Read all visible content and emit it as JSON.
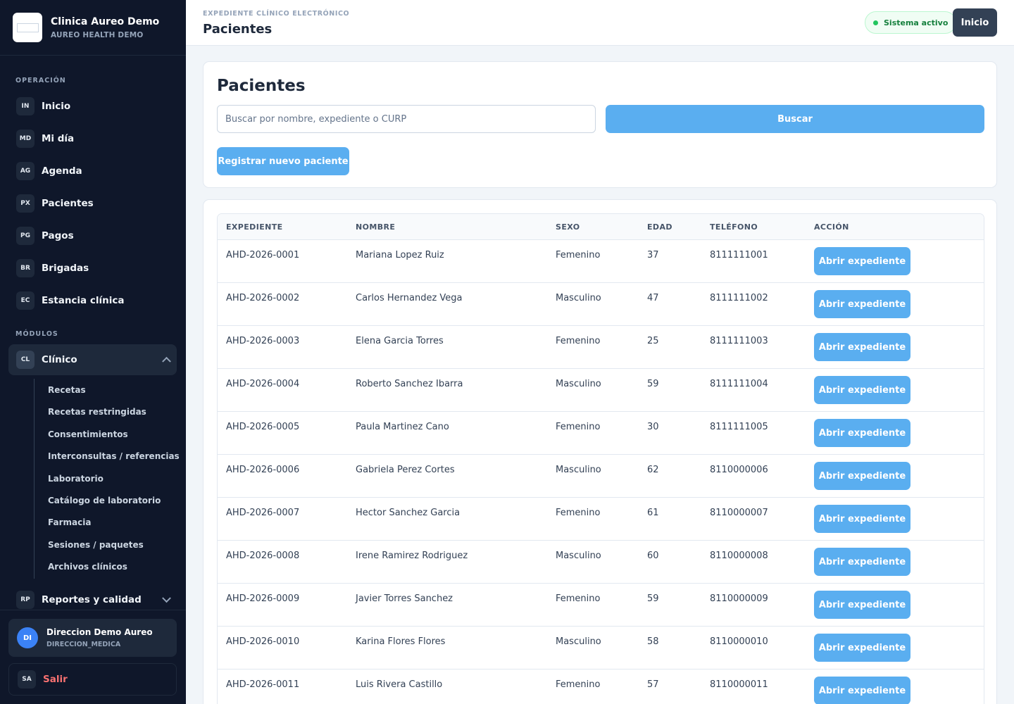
{
  "brand": {
    "name": "Clinica Aureo Demo",
    "subtitle": "AUREO HEALTH DEMO"
  },
  "sidebar": {
    "section_operacion": "OPERACIÓN",
    "operacion_items": [
      {
        "badge": "IN",
        "label": "Inicio"
      },
      {
        "badge": "MD",
        "label": "Mi día"
      },
      {
        "badge": "AG",
        "label": "Agenda"
      },
      {
        "badge": "PX",
        "label": "Pacientes"
      },
      {
        "badge": "PG",
        "label": "Pagos"
      },
      {
        "badge": "BR",
        "label": "Brigadas"
      },
      {
        "badge": "EC",
        "label": "Estancia clínica"
      }
    ],
    "section_modulos": "MÓDULOS",
    "clinico": {
      "badge": "CL",
      "label": "Clínico"
    },
    "clinico_subitems": [
      "Recetas",
      "Recetas restringidas",
      "Consentimientos",
      "Interconsultas / referencias",
      "Laboratorio",
      "Catálogo de laboratorio",
      "Farmacia",
      "Sesiones / paquetes",
      "Archivos clínicos"
    ],
    "reportes": {
      "badge": "RP",
      "label": "Reportes y calidad"
    }
  },
  "user": {
    "initials": "DI",
    "name": "Direccion Demo Aureo",
    "role": "DIRECCION_MEDICA"
  },
  "logout": {
    "badge": "SA",
    "label": "Salir"
  },
  "header": {
    "eyebrow": "EXPEDIENTE CLÍNICO ELECTRÓNICO",
    "title": "Pacientes",
    "status": "Sistema activo",
    "home_button": "Inicio"
  },
  "search": {
    "title": "Pacientes",
    "placeholder": "Buscar por nombre, expediente o CURP",
    "value": "",
    "search_button": "Buscar",
    "register_button": "Registrar nuevo paciente"
  },
  "table": {
    "headers": [
      "EXPEDIENTE",
      "NOMBRE",
      "SEXO",
      "EDAD",
      "TELÉFONO",
      "ACCIÓN"
    ],
    "action_label": "Abrir expediente",
    "rows": [
      [
        "AHD-2026-0001",
        "Mariana Lopez Ruiz",
        "Femenino",
        "37",
        "8111111001"
      ],
      [
        "AHD-2026-0002",
        "Carlos Hernandez Vega",
        "Masculino",
        "47",
        "8111111002"
      ],
      [
        "AHD-2026-0003",
        "Elena Garcia Torres",
        "Femenino",
        "25",
        "8111111003"
      ],
      [
        "AHD-2026-0004",
        "Roberto Sanchez Ibarra",
        "Masculino",
        "59",
        "8111111004"
      ],
      [
        "AHD-2026-0005",
        "Paula Martinez Cano",
        "Femenino",
        "30",
        "8111111005"
      ],
      [
        "AHD-2026-0006",
        "Gabriela Perez Cortes",
        "Masculino",
        "62",
        "8110000006"
      ],
      [
        "AHD-2026-0007",
        "Hector Sanchez Garcia",
        "Femenino",
        "61",
        "8110000007"
      ],
      [
        "AHD-2026-0008",
        "Irene Ramirez Rodriguez",
        "Masculino",
        "60",
        "8110000008"
      ],
      [
        "AHD-2026-0009",
        "Javier Torres Sanchez",
        "Femenino",
        "59",
        "8110000009"
      ],
      [
        "AHD-2026-0010",
        "Karina Flores Flores",
        "Masculino",
        "58",
        "8110000010"
      ],
      [
        "AHD-2026-0011",
        "Luis Rivera Castillo",
        "Femenino",
        "57",
        "8110000011"
      ]
    ]
  },
  "colors": {
    "sidebar_bg": "#0f172a",
    "accent_blue": "#5aaef0",
    "logout_red": "#f87171",
    "status_green": "#22c55e"
  }
}
